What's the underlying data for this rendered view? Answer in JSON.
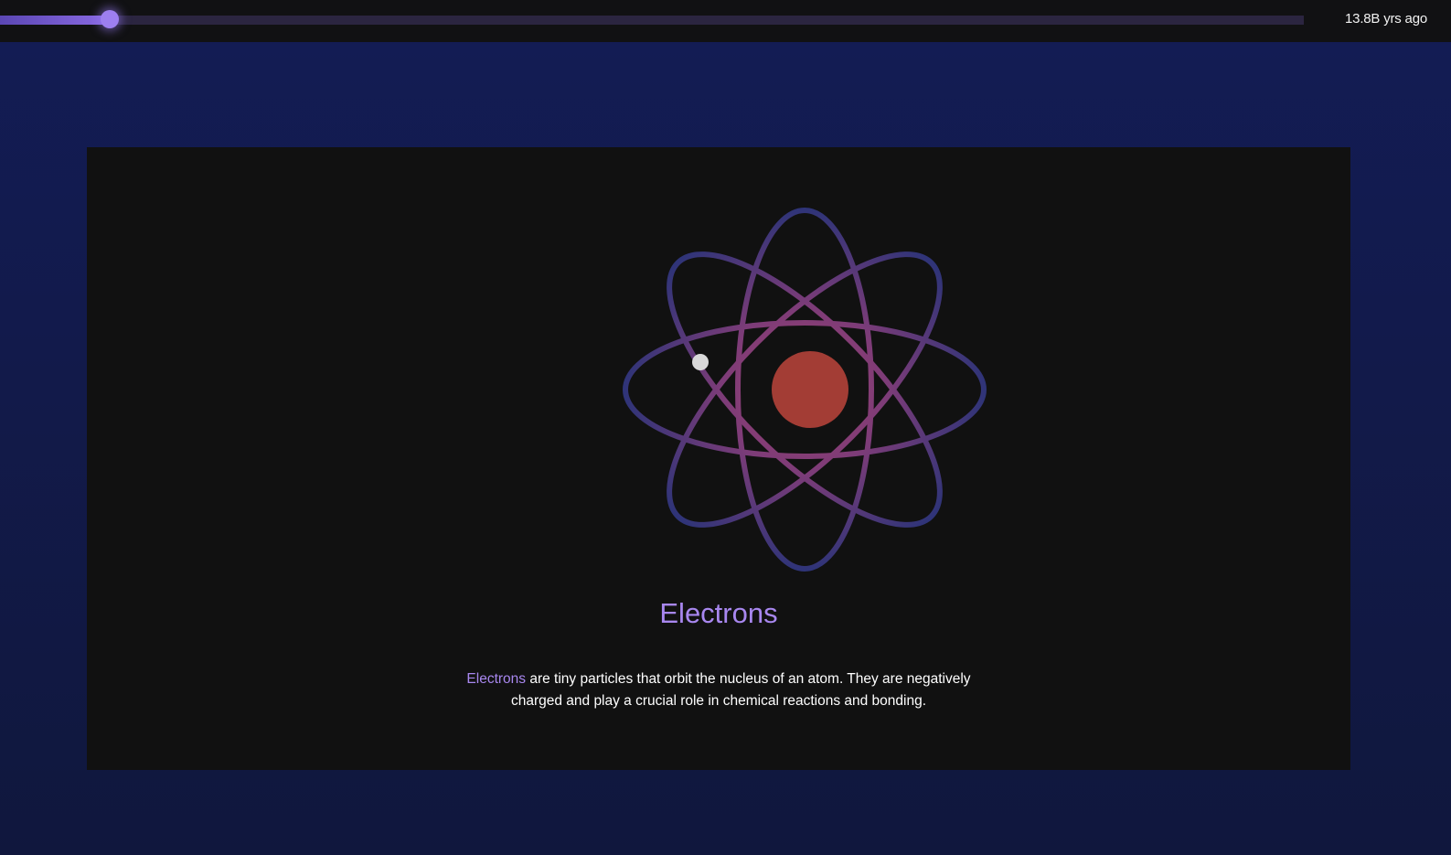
{
  "timeline": {
    "progress_percent": 8.4,
    "time_label": "13.8B yrs ago"
  },
  "card": {
    "title": "Electrons",
    "description_highlight": "Electrons",
    "description_rest": " are tiny particles that orbit the nucleus of an atom. They are negatively charged and play a crucial role in chemical reactions and bonding."
  },
  "icons": {
    "atom": "atom-icon",
    "nucleus": "nucleus-icon",
    "electron": "electron-icon"
  },
  "colors": {
    "accent": "#a887ef",
    "orbit_outer": "#2f3479",
    "orbit_inner": "#8a3f72",
    "nucleus": "#a33d35",
    "electron": "#d9d9d9",
    "card_bg": "#111111",
    "page_bg": "#131c55"
  }
}
